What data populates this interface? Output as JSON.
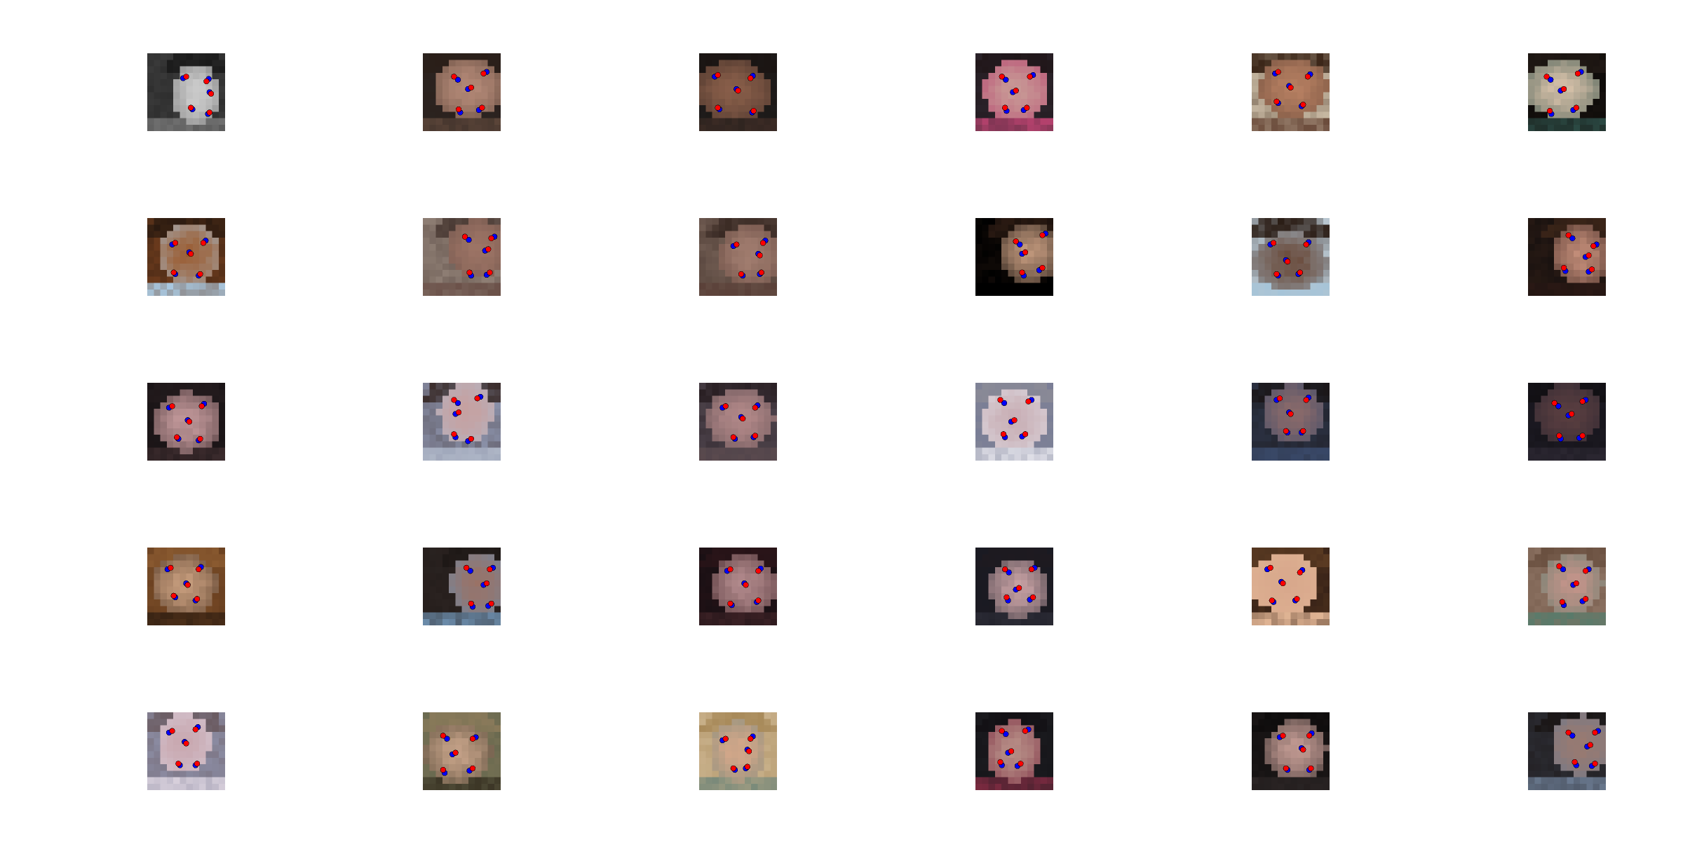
{
  "figure": {
    "background": "#ffffff",
    "rows": 5,
    "cols": 6,
    "marker_colors": {
      "red": "#ff0000",
      "blue": "#0000ff"
    },
    "thumbnails": [
      {
        "palette": {
          "bg": "#3a3a3a",
          "skin": "#cfcfcf",
          "hair": "#1a1a1a",
          "shadow": "#6e6e6e"
        }
      },
      {
        "palette": {
          "bg": "#2b2320",
          "skin": "#b58a78",
          "hair": "#2a1e18",
          "shadow": "#5a4438"
        }
      },
      {
        "palette": {
          "bg": "#1e1b1a",
          "skin": "#8a5f4a",
          "hair": "#1a1412",
          "shadow": "#3a2a24"
        }
      },
      {
        "palette": {
          "bg": "#2a2229",
          "skin": "#c89a96",
          "hair": "#201619",
          "shadow": "#b6426e"
        }
      },
      {
        "palette": {
          "bg": "#c7b8a2",
          "skin": "#b78062",
          "hair": "#3b2618",
          "shadow": "#6a4a3a"
        }
      },
      {
        "palette": {
          "bg": "#0f0c0a",
          "skin": "#d8c2aa",
          "hair": "#201814",
          "shadow": "#2c4a44"
        }
      },
      {
        "palette": {
          "bg": "#6a3a1c",
          "skin": "#9a5a2e",
          "hair": "#2a1a10",
          "shadow": "#a9c8e0"
        }
      },
      {
        "palette": {
          "bg": "#8e7e74",
          "skin": "#9e7566",
          "hair": "#4a3a34",
          "shadow": "#6a5048"
        }
      },
      {
        "palette": {
          "bg": "#6e5a50",
          "skin": "#a58072",
          "hair": "#3a2a24",
          "shadow": "#5a4038"
        }
      },
      {
        "palette": {
          "bg": "#000000",
          "skin": "#c49a7e",
          "hair": "#2a1a12",
          "shadow": "#000000"
        }
      },
      {
        "palette": {
          "bg": "#b8c6d0",
          "skin": "#6a4a3a",
          "hair": "#2a1c14",
          "shadow": "#a6c4d8"
        }
      },
      {
        "palette": {
          "bg": "#1a1210",
          "skin": "#c48e7a",
          "hair": "#3a2418",
          "shadow": "#2a1814"
        }
      },
      {
        "palette": {
          "bg": "#1a1416",
          "skin": "#c49a9c",
          "hair": "#221a1c",
          "shadow": "#3a2a2c"
        }
      },
      {
        "palette": {
          "bg": "#8a90a8",
          "skin": "#c6a0a0",
          "hair": "#3a2c2a",
          "shadow": "#b0b8c8"
        }
      },
      {
        "palette": {
          "bg": "#4a4048",
          "skin": "#b48a8a",
          "hair": "#2a2024",
          "shadow": "#5a4a4e"
        }
      },
      {
        "palette": {
          "bg": "#7a7e96",
          "skin": "#c8aeb4",
          "hair": "#8a8a96",
          "shadow": "#e0e0e8"
        }
      },
      {
        "palette": {
          "bg": "#2a3040",
          "skin": "#8a6a6a",
          "hair": "#1a1618",
          "shadow": "#3a4a6a"
        }
      },
      {
        "palette": {
          "bg": "#1a1820",
          "skin": "#5a3e40",
          "hair": "#121014",
          "shadow": "#2a2630"
        }
      },
      {
        "palette": {
          "bg": "#6a4020",
          "skin": "#caa080",
          "hair": "#8a5a30",
          "shadow": "#3a2414"
        }
      },
      {
        "palette": {
          "bg": "#2a2220",
          "skin": "#9a7266",
          "hair": "#1e1816",
          "shadow": "#6a8aa8"
        }
      },
      {
        "palette": {
          "bg": "#1a1014",
          "skin": "#b48c8e",
          "hair": "#2a1418",
          "shadow": "#3a2024"
        }
      },
      {
        "palette": {
          "bg": "#1a1a22",
          "skin": "#c8a2a4",
          "hair": "#1e1a20",
          "shadow": "#2a2a34"
        }
      },
      {
        "palette": {
          "bg": "#3a2418",
          "skin": "#d8a88c",
          "hair": "#5a3a22",
          "shadow": "#e0b494"
        }
      },
      {
        "palette": {
          "bg": "#8a7060",
          "skin": "#c4948a",
          "hair": "#6a5040",
          "shadow": "#5a7a6a"
        }
      },
      {
        "palette": {
          "bg": "#8a8aa0",
          "skin": "#c8a6ae",
          "hair": "#6a5a60",
          "shadow": "#d8d0dc"
        }
      },
      {
        "palette": {
          "bg": "#6a6a50",
          "skin": "#c8a48a",
          "hair": "#8a7a5a",
          "shadow": "#3a3424"
        }
      },
      {
        "palette": {
          "bg": "#c8b08a",
          "skin": "#d6a88a",
          "hair": "#a88a5a",
          "shadow": "#7a8a7a"
        }
      },
      {
        "palette": {
          "bg": "#1a1a1e",
          "skin": "#b89088",
          "hair": "#121014",
          "shadow": "#7a2a40"
        }
      },
      {
        "palette": {
          "bg": "#1a1616",
          "skin": "#c49c94",
          "hair": "#0e0c0c",
          "shadow": "#2a2424"
        }
      },
      {
        "palette": {
          "bg": "#2a2a30",
          "skin": "#9a7a70",
          "hair": "#1a1616",
          "shadow": "#6a7a90"
        }
      }
    ]
  }
}
